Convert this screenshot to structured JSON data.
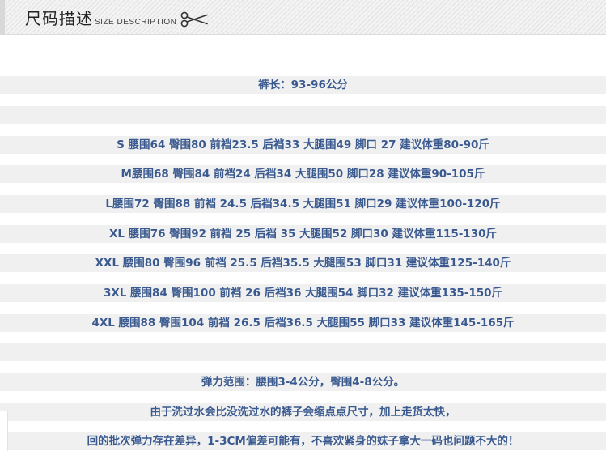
{
  "header": {
    "title": "尺码描述",
    "subtitle": "SIZE DESCRIPTION",
    "icon": "scissors-icon"
  },
  "length": "裤长：93-96公分",
  "sizes": [
    "S 腰围64 臀围80 前裆23.5 后裆33  大腿围49 脚口 27   建议体重80-90斤",
    "M腰围68 臀围84 前裆24  后裆34  大腿围50 脚口28 建议体重90-105斤",
    "L腰围72 臀围88 前裆 24.5  后裆34.5  大腿围51 脚口29  建议体重100-120斤",
    "XL 腰围76 臀围92 前裆 25  后裆 35  大腿围52 脚口30  建议体重115-130斤",
    "XXL 腰围80 臀围96 前裆 25.5  后裆35.5  大腿围53 脚口31  建议体重125-140斤",
    "3XL 腰围84 臀围100 前裆 26  后裆36  大腿围54 脚口32  建议体重135-150斤",
    "4XL 腰围88 臀围104 前裆 26.5  后裆36.5  大腿围55 脚口33  建议体重145-165斤"
  ],
  "elasticity": "弹力范围：腰围3-4公分，臀围4-8公分。",
  "notes": [
    "由于洗过水会比没洗过水的裤子会缩点点尺寸，加上走货太快，",
    "回的批次弹力存在差异，1-3CM偏差可能有，不喜欢紧身的妹子拿大一码也问题不大的！"
  ]
}
